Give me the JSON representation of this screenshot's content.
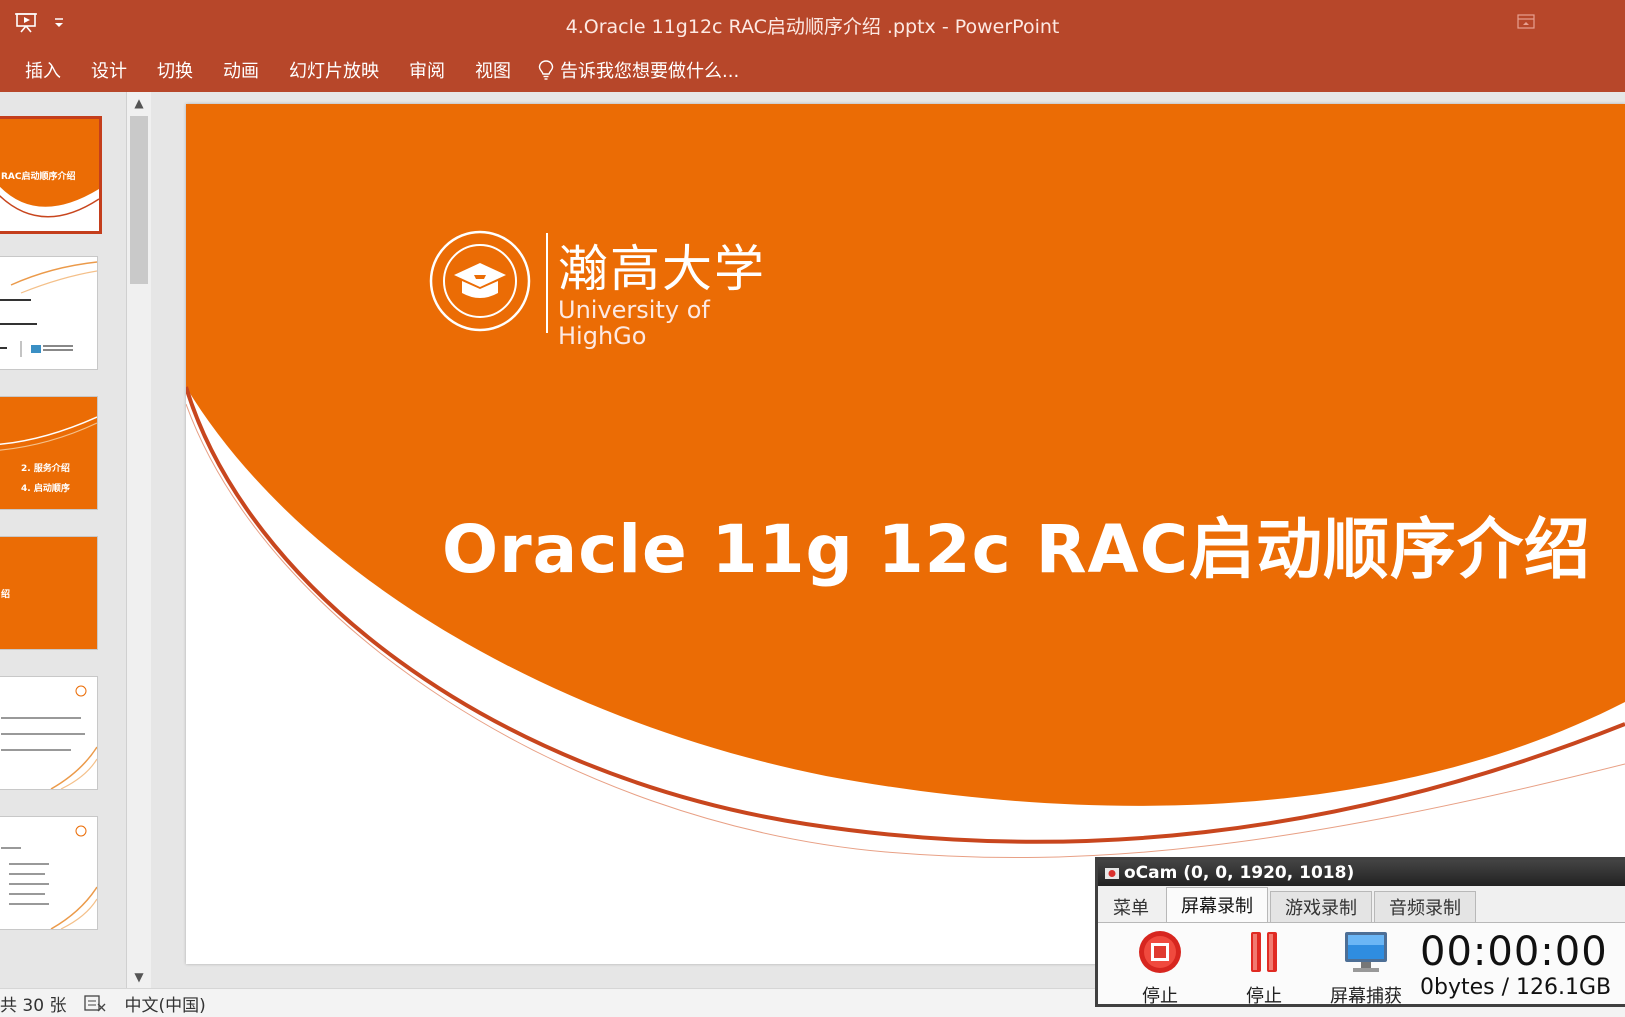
{
  "window": {
    "title": "4.Oracle 11g12c RAC启动顺序介绍 .pptx - PowerPoint"
  },
  "ribbon": {
    "tabs": [
      "插入",
      "设计",
      "切换",
      "动画",
      "幻灯片放映",
      "审阅",
      "视图"
    ],
    "tell_me": "告诉我您想要做什么..."
  },
  "thumbnails": {
    "slide1_label": "RAC启动顺序介绍",
    "slide3_label1": "2. 服务介绍",
    "slide3_label2": "4. 启动顺序",
    "slide4_label": "绍"
  },
  "slide": {
    "logo_cn": "瀚高大学",
    "logo_en_line1": "University of",
    "logo_en_line2": "HighGo",
    "title": "Oracle 11g 12c RAC启动顺序介绍",
    "colors": {
      "orange": "#eb6c05",
      "accent_line": "#c8461e"
    }
  },
  "statusbar": {
    "slide_count": "共 30 张",
    "language": "中文(中国)"
  },
  "ocam": {
    "title": "oCam (0, 0, 1920, 1018)",
    "tabs": [
      "菜单",
      "屏幕录制",
      "游戏录制",
      "音频录制"
    ],
    "stop_label": "停止",
    "pause_label": "停止",
    "capture_label": "屏幕捕获",
    "timer": "00:00:00",
    "size": "0bytes / 126.1GB"
  }
}
